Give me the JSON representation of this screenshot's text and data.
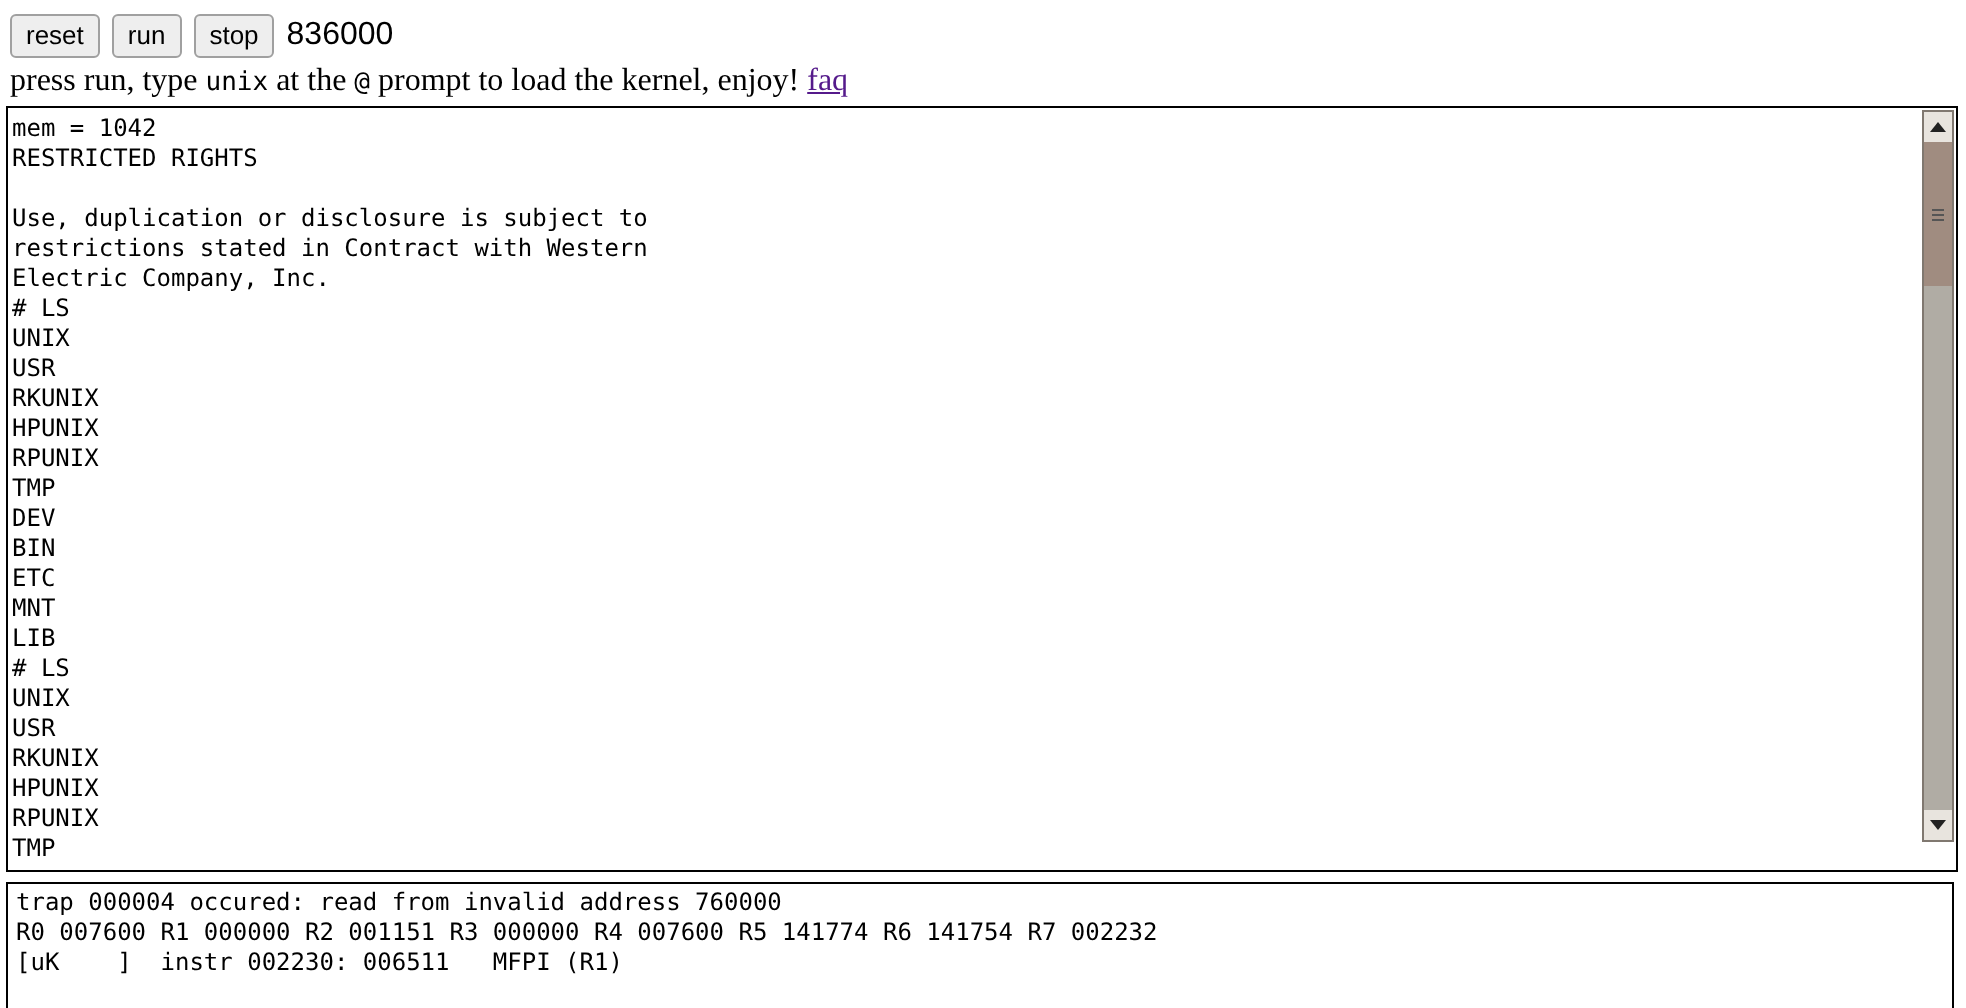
{
  "buttons": [
    "reset",
    "run",
    "stop"
  ],
  "counter": "836000",
  "instructions": {
    "parts": [
      {
        "kind": "text",
        "text": "press run, type "
      },
      {
        "kind": "code",
        "text": "unix"
      },
      {
        "kind": "text",
        "text": " at the "
      },
      {
        "kind": "code",
        "text": "@"
      },
      {
        "kind": "text",
        "text": " prompt to load the kernel, enjoy!"
      }
    ],
    "link": "faq"
  },
  "terminal": {
    "lines": [
      "mem = 1042",
      "RESTRICTED RIGHTS",
      {
        "kind": "blank"
      },
      "Use, duplication or disclosure is subject to",
      "restrictions stated in Contract with Western",
      "Electric Company, Inc.",
      "# LS",
      "UNIX",
      "USR",
      "RKUNIX",
      "HPUNIX",
      "RPUNIX",
      "TMP",
      "DEV",
      "BIN",
      "ETC",
      "MNT",
      "LIB",
      "# LS",
      "UNIX",
      "USR",
      "RKUNIX",
      "HPUNIX",
      "RPUNIX",
      "TMP"
    ]
  },
  "debug": {
    "lines": [
      "trap 000004 occured: read from invalid address 760000",
      "R0 007600 R1 000000 R2 001151 R3 000000 R4 007600 R5 141774 R6 141754 R7 002232",
      "[uK    ]  instr 002230: 006511   MFPI (R1)"
    ]
  }
}
